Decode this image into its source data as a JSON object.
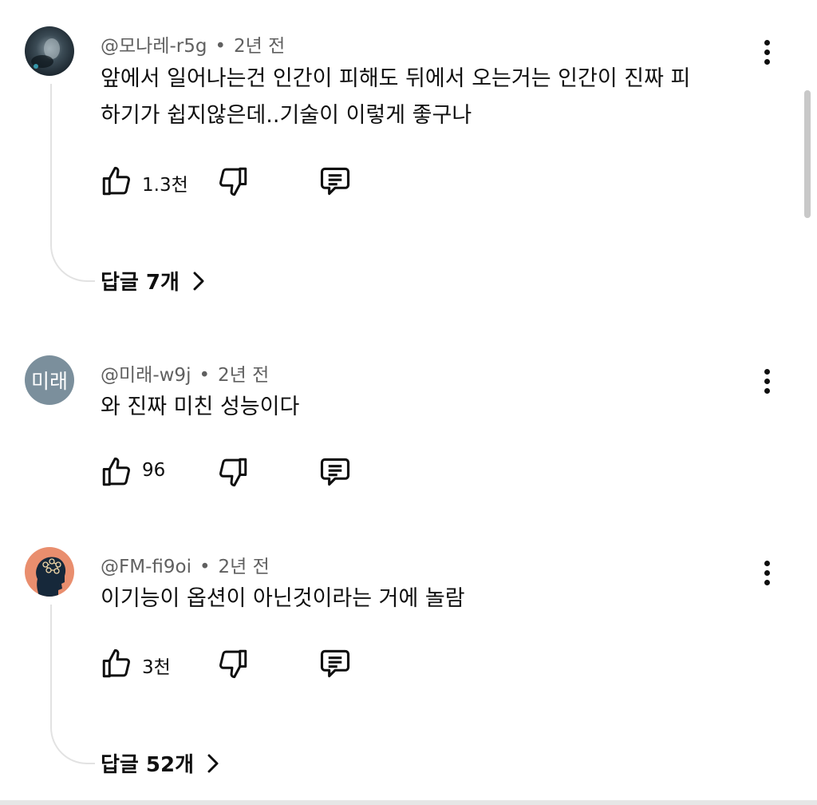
{
  "comments": [
    {
      "author": "@모나레-r5g",
      "time": "2년 전",
      "text_lines": [
        "앞에서 일어나는건 인간이 피해도 뒤에서 오는거는 인간이 진짜 피",
        "하기가 쉽지않은데..기술이 이렇게 좋구나"
      ],
      "likes": "1.3천",
      "replies": "답글 7개",
      "avatar_icon": "dark-photo-avatar"
    },
    {
      "author": "@미래-w9j",
      "time": "2년 전",
      "text_lines": [
        "와 진짜 미친 성능이다"
      ],
      "likes": "96",
      "avatar_initials": "미래",
      "avatar_color": "#7b8f9c"
    },
    {
      "author": "@FM-fi9oi",
      "time": "2년 전",
      "text_lines": [
        "이기능이 옵션이 아닌것이라는 거에 놀람"
      ],
      "likes": "3천",
      "replies": "답글 52개",
      "avatar_icon": "brain-profile-avatar"
    }
  ],
  "icons": {
    "like": "thumbs-up-icon",
    "dislike": "thumbs-down-icon",
    "reply": "comment-icon",
    "menu": "more-vertical-icon",
    "replies_chevron": "chevron-right-icon"
  }
}
